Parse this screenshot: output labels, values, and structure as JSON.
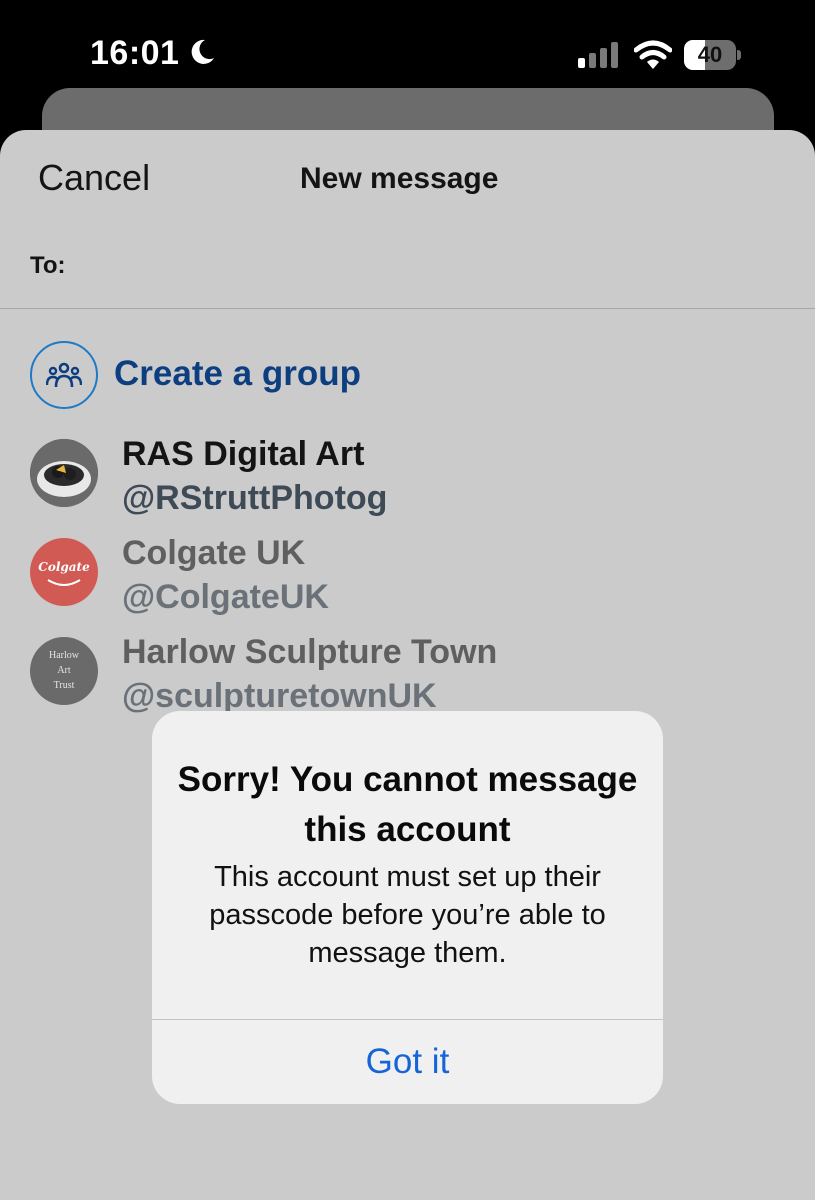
{
  "status_bar": {
    "time": "16:01",
    "battery": "40",
    "battery_level": 0.4,
    "icons": [
      "moon-icon",
      "cellular-signal-icon",
      "wifi-icon",
      "battery-icon"
    ]
  },
  "sheet": {
    "cancel_label": "Cancel",
    "title": "New message",
    "to_label": "To:"
  },
  "create_group": {
    "label": "Create a group",
    "icon": "people-group-icon",
    "accent": "#1d7ac7"
  },
  "contacts": [
    {
      "name": "RAS Digital Art",
      "handle": "@RStruttPhotog"
    },
    {
      "name": "Colgate UK",
      "handle": "@ColgateUK",
      "avatar_text": "Colgate",
      "avatar_color": "#d25a54"
    },
    {
      "name": "Harlow Sculpture Town",
      "handle": "@sculpturetownUK",
      "avatar_text": "Harlow\nArt\nTrust"
    }
  ],
  "alert": {
    "title": "Sorry! You cannot message this account",
    "message": "This account must set up their passcode before you’re able to message them.",
    "button_label": "Got it",
    "button_color": "#1565d8"
  }
}
